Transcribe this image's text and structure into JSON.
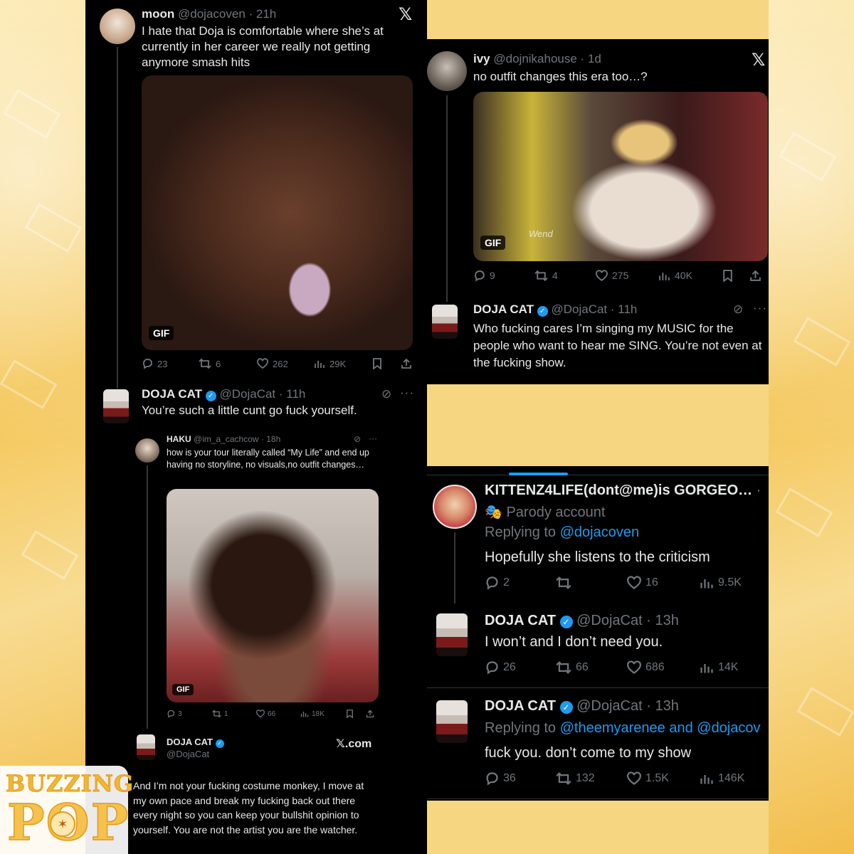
{
  "brand": {
    "line1": "BUZZING",
    "line2": "POP"
  },
  "tweet_moon": {
    "name": "moon",
    "handle": "@dojacoven",
    "time": "21h",
    "text": "I hate that Doja is comfortable where she’s at currently in her career we really not getting anymore smash hits",
    "media_badge": "GIF",
    "stats": {
      "replies": "23",
      "retweets": "6",
      "likes": "262",
      "views": "29K"
    }
  },
  "reply_doja_1": {
    "name": "DOJA CAT",
    "handle": "@DojaCat",
    "time": "11h",
    "text": "You’re such a little cunt go fuck yourself."
  },
  "quoted_haku": {
    "name": "HAKU",
    "handle": "@im_a_cachcow",
    "time": "18h",
    "text": "how is your tour literally called “My Life” and end up having no storyline, no visuals,no outfit changes…",
    "media_badge": "GIF",
    "stats": {
      "replies": "3",
      "retweets": "1",
      "likes": "66",
      "views": "18K"
    }
  },
  "reply_doja_2": {
    "name": "DOJA CAT",
    "handle": "@DojaCat",
    "source": "𝕏.com",
    "text": "And I’m not your fucking costume monkey, I move at my own pace and break my fucking back out there every night so you can keep your bullshit opinion to yourself. You are not the artist you are the watcher."
  },
  "tweet_ivy": {
    "name": "ivy",
    "handle": "@dojnikahouse",
    "time": "1d",
    "text": "no outfit changes this era too…?",
    "media_badge": "GIF",
    "media_caption": "Wend",
    "stats": {
      "replies": "9",
      "retweets": "4",
      "likes": "275",
      "views": "40K"
    }
  },
  "reply_doja_3": {
    "name": "DOJA CAT",
    "handle": "@DojaCat",
    "time": "11h",
    "text": "Who fucking cares I’m singing my MUSIC for the people who want to hear me SING. You’re not even at the fucking show."
  },
  "tweet_kittenz": {
    "name": "KITTENZ4LIFE(dont@me)is GORGEO…",
    "badge": "Parody account",
    "replying_label": "Replying to",
    "replying_to": "@dojacoven",
    "text": "Hopefully she listens to the criticism",
    "stats": {
      "replies": "2",
      "likes": "16",
      "views": "9.5K"
    }
  },
  "reply_doja_4": {
    "name": "DOJA CAT",
    "handle": "@DojaCat",
    "time": "13h",
    "text": "I won’t and I don’t need you.",
    "stats": {
      "replies": "26",
      "retweets": "66",
      "likes": "686",
      "views": "14K"
    }
  },
  "reply_doja_5": {
    "name": "DOJA CAT",
    "handle": "@DojaCat",
    "time": "13h",
    "replying_label": "Replying to",
    "replying_to": "@theemyarenee and @dojacov",
    "text": "fuck you. don’t come to my show",
    "stats": {
      "replies": "36",
      "retweets": "132",
      "likes": "1.5K",
      "views": "146K"
    }
  },
  "colors": {
    "background": "#000000",
    "text": "#e7e9ea",
    "muted": "#71767b",
    "accent": "#1d9bf0",
    "brand": "#f2b632"
  }
}
